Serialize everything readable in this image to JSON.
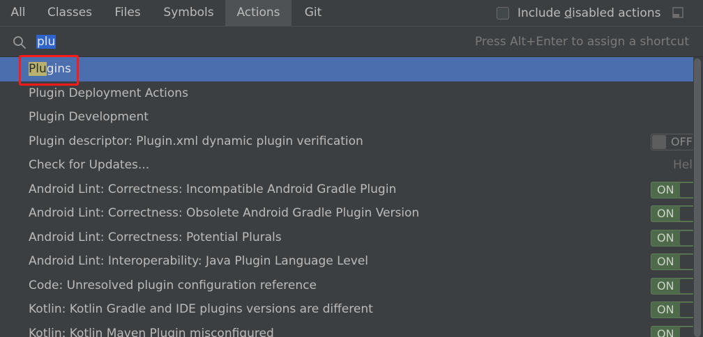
{
  "tabs": [
    {
      "label": "All",
      "active": false
    },
    {
      "label": "Classes",
      "active": false
    },
    {
      "label": "Files",
      "active": false
    },
    {
      "label": "Symbols",
      "active": false
    },
    {
      "label": "Actions",
      "active": true
    },
    {
      "label": "Git",
      "active": false
    }
  ],
  "include_disabled": {
    "label_before": "Include ",
    "label_mnemonic": "d",
    "label_after": "isabled actions",
    "checked": false
  },
  "search": {
    "query": "plu",
    "hint": "Press Alt+Enter to assign a shortcut"
  },
  "results": [
    {
      "match": "Plu",
      "rest": "gins",
      "selected": true
    },
    {
      "label": "Plugin Deployment Actions"
    },
    {
      "label": "Plugin Development"
    },
    {
      "label": "Plugin descriptor: Plugin.xml dynamic plugin verification",
      "toggle": "OFF"
    },
    {
      "label": "Check for Updates...",
      "extra": "Help"
    },
    {
      "label": "Android Lint: Correctness: Incompatible Android Gradle Plugin",
      "toggle": "ON"
    },
    {
      "label": "Android Lint: Correctness: Obsolete Android Gradle Plugin Version",
      "toggle": "ON"
    },
    {
      "label": "Android Lint: Correctness: Potential Plurals",
      "toggle": "ON"
    },
    {
      "label": "Android Lint: Interoperability: Java Plugin Language Level",
      "toggle": "ON"
    },
    {
      "label": "Code: Unresolved plugin configuration reference",
      "toggle": "ON"
    },
    {
      "label": "Kotlin: Kotlin Gradle and IDE plugins versions are different",
      "toggle": "ON"
    },
    {
      "label": "Kotlin: Kotlin Maven Plugin misconfigured",
      "toggle": "ON"
    }
  ],
  "colors": {
    "background": "#3c3f41",
    "selected_row": "#4b6eaf",
    "active_tab": "#4e5254",
    "match_highlight": "#b9b26f",
    "annotation_box": "#ff1a1a",
    "toggle_on": "#4f6a4b"
  },
  "icons": {
    "search": "search-icon",
    "pin": "pin-window-icon"
  }
}
